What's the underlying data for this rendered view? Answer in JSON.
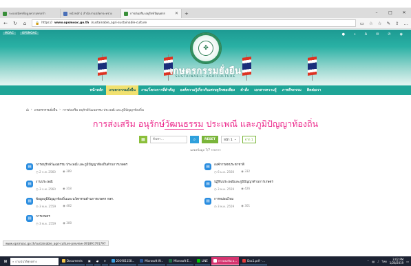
{
  "browser": {
    "tabs": [
      {
        "label": "ระบบสมัครข้อมูลความทรงจำ",
        "active": false
      },
      {
        "label": "หน้าหลัก | สำนักงานปลัดกระทรวง",
        "active": false
      },
      {
        "label": "การส่งเสริม อนุรักษ์วัฒนธรร",
        "active": true
      }
    ],
    "new_tab": "+",
    "url_prefix": "https://",
    "url_host": "www.opsmoac.go.th",
    "url_path": "/sustainable_agri-sustainable-culture",
    "window_buttons": [
      "–",
      "□",
      "✕"
    ]
  },
  "site": {
    "top_links": [
      "MOAC",
      "OPSMOAC"
    ],
    "brand_title": "เกษตรกรรมยั่งยืน",
    "brand_subtitle": "SUSTAINABLE AGRICULTURE",
    "menu": [
      {
        "label": "หน้าหลัก",
        "active": false
      },
      {
        "label": "เกษตรกรรมยั่งยืน",
        "active": true
      },
      {
        "label": "งาน/โครงการที่สำคัญ",
        "active": false
      },
      {
        "label": "องค์ความรู้เกี่ยวกับเศรษฐกิจพอเพียง",
        "active": false
      },
      {
        "label": "คำสั่ง",
        "active": false
      },
      {
        "label": "เอกสารความรู้",
        "active": false
      },
      {
        "label": "ภาพกิจกรรม",
        "active": false
      },
      {
        "label": "ติดต่อเรา",
        "active": false
      }
    ]
  },
  "breadcrumb": [
    "เกษตรกรรมยั่งยืน",
    "การส่งเสริม อนุรักษ์วัฒนธรรม ประเพณี และภูมิปัญญาท้องถิ่น"
  ],
  "page": {
    "title_a": "การส่งเสริม อนุรักษ์",
    "title_u": "วัฒนธรรม",
    "title_b": " ประเพณี และภูมิปัญญาท้องถิ่น"
  },
  "search": {
    "placeholder": "ค้นหา...",
    "reset_label": "RESET",
    "page_select": "หน้า 1",
    "page_of": "จาก 1",
    "count": "แสดงข้อมูล 7/7 รายการ"
  },
  "items": [
    {
      "title": "การอนุรักษ์วัฒนธรรม ประเพณี และภูมิปัญญาท้องถิ่นด้านการเกษตร",
      "date": "2 ก.พ. 2560",
      "views": "389"
    },
    {
      "title": "องค์การสหประชาชาติ",
      "date": "6 ม.ค. 2560",
      "views": "332"
    },
    {
      "title": "งานประเพณี",
      "date": "3 ก.พ. 2560",
      "views": "318"
    },
    {
      "title": "ปฏิทินประเพณีและภูมิปัญญาด้านการเกษตร",
      "date": "3 พ.ค. 2559",
      "views": "426"
    },
    {
      "title": "ข้อมูลภูมิปัญญาท้องถิ่นและนวัตกรรมด้านการเกษตร กษร.",
      "date": "3 พ.ค. 2559",
      "views": "482"
    },
    {
      "title": "การหม่อนไหม",
      "date": "3 พ.ค. 2559",
      "views": "301"
    },
    {
      "title": "การเกษตร",
      "date": "3 พ.ค. 2559",
      "views": "380"
    }
  ],
  "status_url": "www.opsmoac.go.th/sustainable_agri-culture-preview-391891791797",
  "taskbar": {
    "search": "ถามฉันได้ทุกอย่าง",
    "items": [
      {
        "label": "Documents",
        "active": false
      },
      {
        "label": "201901158...",
        "active": false
      },
      {
        "label": "Microsoft W...",
        "active": false
      },
      {
        "label": "Microsoft E...",
        "active": false
      },
      {
        "label": "LINE",
        "active": false
      },
      {
        "label": "การส่งเสริม อ...",
        "active": true
      },
      {
        "label": "Doc1.pdf - ...",
        "active": false
      }
    ],
    "lang": "ไทย",
    "time": "3:02 PM",
    "date": "1/28/2019"
  },
  "colors": {
    "teal": "#1fa597",
    "active_menu": "#f1e16f",
    "title_pink": "#ec2a8c",
    "search_blue": "#2fa0dc",
    "green": "#7ab53a"
  }
}
